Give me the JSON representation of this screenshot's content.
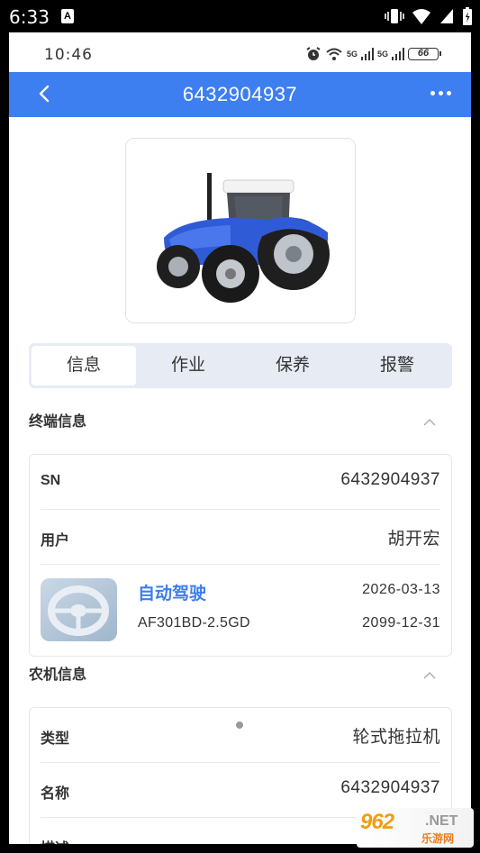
{
  "os_status": {
    "time": "6:33",
    "notification_icon": "A"
  },
  "phone_status": {
    "time": "10:46",
    "signal1": "5G",
    "signal2": "5G",
    "battery": "66"
  },
  "header": {
    "title": "6432904937"
  },
  "tabs": [
    {
      "label": "信息",
      "active": true
    },
    {
      "label": "作业",
      "active": false
    },
    {
      "label": "保养",
      "active": false
    },
    {
      "label": "报警",
      "active": false
    }
  ],
  "terminal_section": {
    "title": "终端信息",
    "rows": [
      {
        "label": "SN",
        "value": "6432904937"
      },
      {
        "label": "用户",
        "value": "胡开宏"
      }
    ],
    "device": {
      "name": "自动驾驶",
      "model": "AF301BD-2.5GD",
      "start_date": "2026-03-13",
      "end_date": "2099-12-31"
    }
  },
  "machine_section": {
    "title": "农机信息",
    "rows": [
      {
        "label": "类型",
        "value": "轮式拖拉机"
      },
      {
        "label": "名称",
        "value": "6432904937"
      },
      {
        "label": "描述",
        "value": ""
      }
    ]
  },
  "watermark": {
    "number": "962",
    "suffix": ".NET",
    "site": "乐游网"
  },
  "colors": {
    "accent": "#3d7ef0",
    "tab_bg": "#e7ecf4",
    "text": "#333333"
  }
}
